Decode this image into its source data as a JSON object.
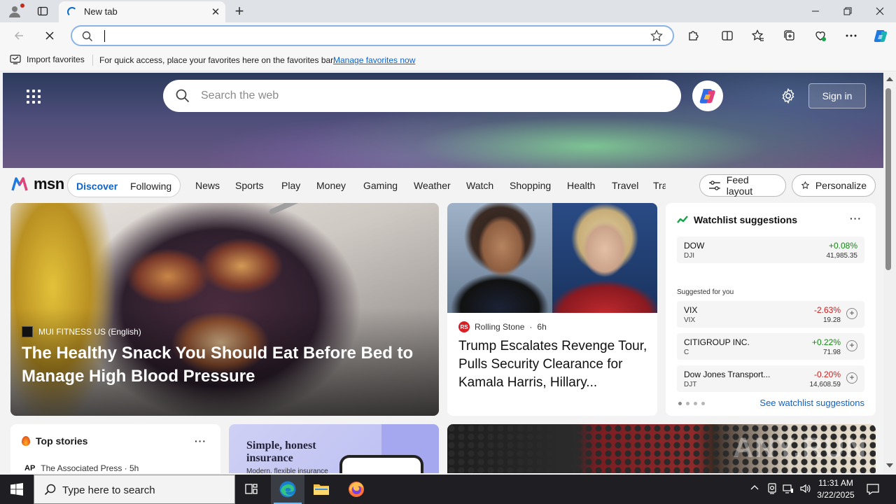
{
  "browser": {
    "tab": {
      "title": "New tab"
    },
    "address": {
      "value": ""
    },
    "favorites_bar": {
      "import_label": "Import favorites",
      "message": "For quick access, place your favorites here on the favorites bar.",
      "manage_link": "Manage favorites now"
    }
  },
  "hero": {
    "search_placeholder": "Search the web",
    "sign_in": "Sign in"
  },
  "msn": {
    "logo": "msn",
    "toggle": {
      "discover": "Discover",
      "following": "Following"
    },
    "nav": [
      "News",
      "Sports",
      "Play",
      "Money",
      "Gaming",
      "Weather",
      "Watch",
      "Shopping",
      "Health",
      "Travel",
      "Tra"
    ],
    "feed_layout": "Feed layout",
    "personalize": "Personalize"
  },
  "cards": {
    "hero": {
      "source": "MUI FITNESS US (English)",
      "title": "The Healthy Snack You Should Eat Before Bed to Manage High Blood Pressure"
    },
    "news": {
      "source": "Rolling Stone",
      "source_logo": "RS",
      "age": "6h",
      "title": "Trump Escalates Revenge Tour, Pulls Security Clearance for Kamala Harris, Hillary..."
    },
    "watchlist": {
      "title": "Watchlist suggestions",
      "main": {
        "name": "DOW",
        "ticker": "DJI",
        "change": "+0.08%",
        "price": "41,985.35"
      },
      "suggested_label": "Suggested for you",
      "items": [
        {
          "name": "VIX",
          "ticker": "VIX",
          "change": "-2.63%",
          "price": "19.28"
        },
        {
          "name": "CITIGROUP INC.",
          "ticker": "C",
          "change": "+0.22%",
          "price": "71.98"
        },
        {
          "name": "Dow Jones Transport...",
          "ticker": "DJT",
          "change": "-0.20%",
          "price": "14,608.59"
        }
      ],
      "see_link": "See watchlist suggestions"
    },
    "top_stories": {
      "title": "Top stories",
      "source_logo": "AP",
      "source": "The Associated Press · 5h"
    },
    "ad": {
      "title": "Simple, honest insurance",
      "subtitle": "Modern, flexible insurance"
    },
    "image_card": {
      "watermark": "ANY.RUN"
    }
  },
  "taskbar": {
    "search_placeholder": "Type here to search",
    "time": "11:31 AM",
    "date": "3/22/2025"
  },
  "colors": {
    "accent": "#0e63c6",
    "positive": "#118811",
    "negative": "#cf1b1b"
  }
}
